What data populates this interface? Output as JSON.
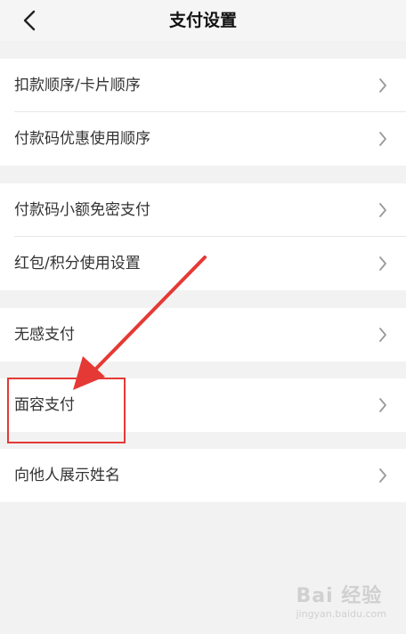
{
  "header": {
    "title": "支付设置",
    "back_icon": "chevron-left-icon"
  },
  "groups": [
    {
      "items": [
        {
          "label": "扣款顺序/卡片顺序"
        },
        {
          "label": "付款码优惠使用顺序"
        }
      ]
    },
    {
      "items": [
        {
          "label": "付款码小额免密支付"
        },
        {
          "label": "红包/积分使用设置"
        }
      ]
    },
    {
      "items": [
        {
          "label": "无感支付"
        }
      ]
    },
    {
      "items": [
        {
          "label": "面容支付"
        }
      ]
    },
    {
      "items": [
        {
          "label": "向他人展示姓名"
        }
      ]
    }
  ],
  "annotation": {
    "highlight_color": "#e53935",
    "arrow_color": "#e53935",
    "target": "面容支付"
  },
  "watermark": {
    "text": "Bai 经验",
    "sub": "jingyan.baidu.com"
  },
  "colors": {
    "background": "#f2f2f2",
    "row_background": "#ffffff",
    "chevron": "#999999"
  }
}
